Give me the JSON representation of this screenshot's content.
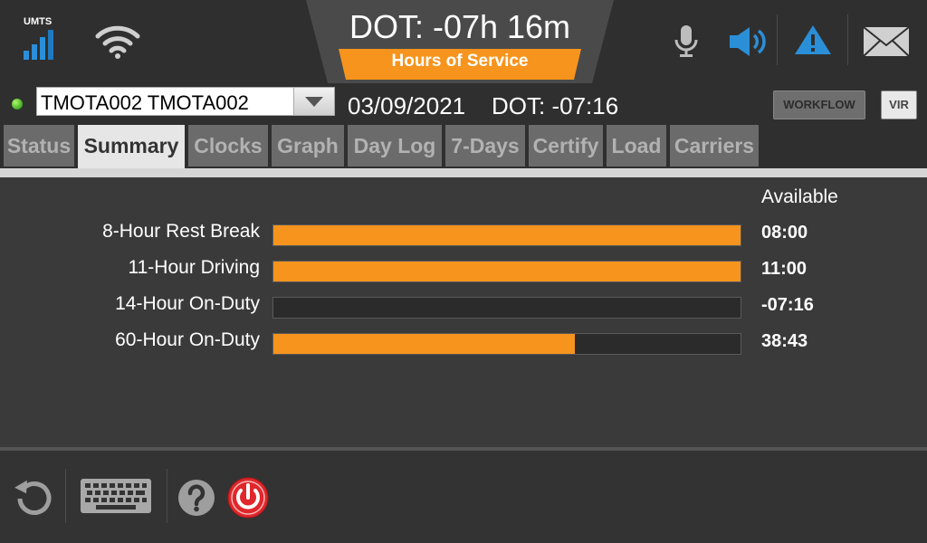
{
  "status_bar": {
    "network_label": "UMTS",
    "dot_remaining": "DOT: -07h 16m",
    "module_label": "Hours of Service",
    "icons": [
      "signal-icon",
      "wifi-icon",
      "microphone-icon",
      "speaker-icon",
      "warning-icon",
      "mail-icon"
    ]
  },
  "driver_row": {
    "driver_selected": "TMOTA002 TMOTA002",
    "date": "03/09/2021",
    "dot_short": "DOT: -07:16",
    "workflow_label": "WORKFLOW",
    "vir_label": "VIR"
  },
  "tabs": [
    {
      "label": "Status",
      "active": false
    },
    {
      "label": "Summary",
      "active": true
    },
    {
      "label": "Clocks",
      "active": false
    },
    {
      "label": "Graph",
      "active": false
    },
    {
      "label": "Day Log",
      "active": false
    },
    {
      "label": "7-Days",
      "active": false
    },
    {
      "label": "Certify",
      "active": false
    },
    {
      "label": "Load",
      "active": false
    },
    {
      "label": "Carriers",
      "active": false
    }
  ],
  "summary": {
    "available_header": "Available",
    "rows": [
      {
        "label": "8-Hour Rest Break",
        "value": "08:00",
        "fill_fraction": 1.0
      },
      {
        "label": "11-Hour Driving",
        "value": "11:00",
        "fill_fraction": 1.0
      },
      {
        "label": "14-Hour On-Duty",
        "value": "-07:16",
        "fill_fraction": 0.0
      },
      {
        "label": "60-Hour On-Duty",
        "value": "38:43",
        "fill_fraction": 0.645
      }
    ]
  },
  "bottom_bar": {
    "icons": [
      "refresh-icon",
      "keyboard-icon",
      "help-icon",
      "power-icon"
    ]
  },
  "colors": {
    "accent_orange": "#f7941d",
    "signal_blue": "#2b8fd8",
    "background": "#3a3a3a",
    "power_red": "#e0272b"
  }
}
